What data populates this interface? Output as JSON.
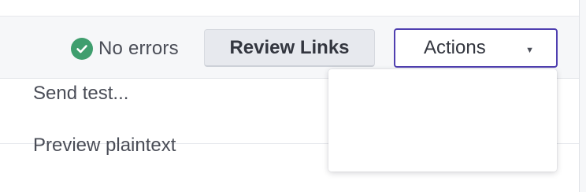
{
  "status": {
    "icon": "check-circle-icon",
    "text": "No errors",
    "color": "#3f9e6e"
  },
  "toolbar": {
    "review_links_label": "Review Links",
    "actions_label": "Actions",
    "actions_icon": "caret-down-icon",
    "accent_color": "#4f3fb0"
  },
  "actions_menu": {
    "items": [
      {
        "label": "Send test..."
      },
      {
        "label": "Preview plaintext"
      }
    ]
  }
}
